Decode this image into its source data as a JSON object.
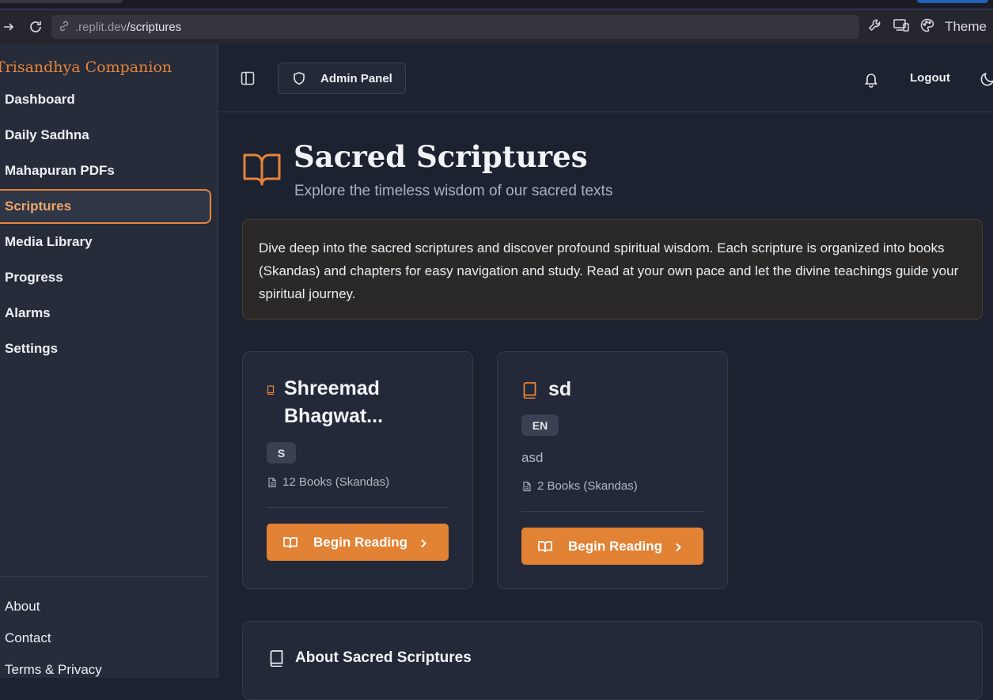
{
  "browser": {
    "url_host": ".replit.dev",
    "url_path": "/scriptures",
    "theme_label": "Theme"
  },
  "sidebar": {
    "brand": "Trisandhya Companion",
    "items": [
      {
        "label": "Dashboard"
      },
      {
        "label": "Daily Sadhna"
      },
      {
        "label": "Mahapuran PDFs"
      },
      {
        "label": "Scriptures"
      },
      {
        "label": "Media Library"
      },
      {
        "label": "Progress"
      },
      {
        "label": "Alarms"
      },
      {
        "label": "Settings"
      }
    ],
    "active_index": 3,
    "footer": [
      {
        "label": "About"
      },
      {
        "label": "Contact"
      },
      {
        "label": "Terms & Privacy"
      }
    ]
  },
  "header": {
    "admin_label": "Admin Panel",
    "logout_label": "Logout"
  },
  "page": {
    "title": "Sacred Scriptures",
    "subtitle": "Explore the timeless wisdom of our sacred texts",
    "intro": "Dive deep into the sacred scriptures and discover profound spiritual wisdom. Each scripture is organized into books (Skandas) and chapters for easy navigation and study. Read at your own pace and let the divine teachings guide your spiritual journey."
  },
  "scriptures": [
    {
      "title": "Shreemad Bhagwat...",
      "badge": "S",
      "description": "",
      "books": "12 Books (Skandas)",
      "button": "Begin Reading"
    },
    {
      "title": "sd",
      "badge": "EN",
      "description": "asd",
      "books": "2 Books (Skandas)",
      "button": "Begin Reading"
    }
  ],
  "about": {
    "title": "About Sacred Scriptures"
  },
  "colors": {
    "accent": "#e28234",
    "background": "#1d2230",
    "sidebar": "#262c39",
    "card": "#232938"
  },
  "icons": [
    "back-icon",
    "reload-icon",
    "link-icon",
    "wrench-icon",
    "devices-icon",
    "palette-icon",
    "sidebar-toggle-icon",
    "shield-icon",
    "bell-icon",
    "moon-icon",
    "book-open-icon",
    "book-icon",
    "file-text-icon",
    "chevron-right-icon"
  ]
}
